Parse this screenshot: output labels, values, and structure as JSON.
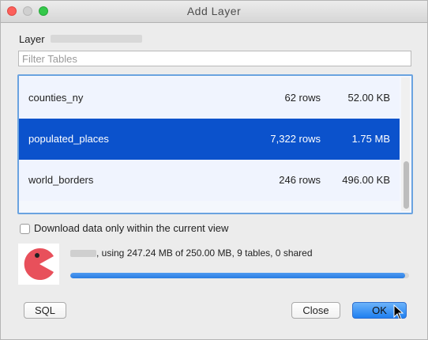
{
  "window": {
    "title": "Add  Layer"
  },
  "layer_section": {
    "label": "Layer",
    "filter_placeholder": "Filter Tables"
  },
  "tables": [
    {
      "name": "counties_ny",
      "rows": "62 rows",
      "size": "52.00 KB",
      "selected": false
    },
    {
      "name": "populated_places",
      "rows": "7,322 rows",
      "size": "1.75 MB",
      "selected": true
    },
    {
      "name": "world_borders",
      "rows": "246 rows",
      "size": "496.00 KB",
      "selected": false
    }
  ],
  "download_option": {
    "label": "Download data only within the current view",
    "checked": false
  },
  "account": {
    "usage_text": ", using 247.24 MB of 250.00 MB, 9 tables, 0 shared",
    "usage_fraction": 0.989
  },
  "buttons": {
    "sql": "SQL",
    "close": "Close",
    "ok": "OK"
  },
  "colors": {
    "selection": "#0b52cc",
    "accent_blue": "#2a7de2",
    "avatar_red": "#e8505b"
  }
}
